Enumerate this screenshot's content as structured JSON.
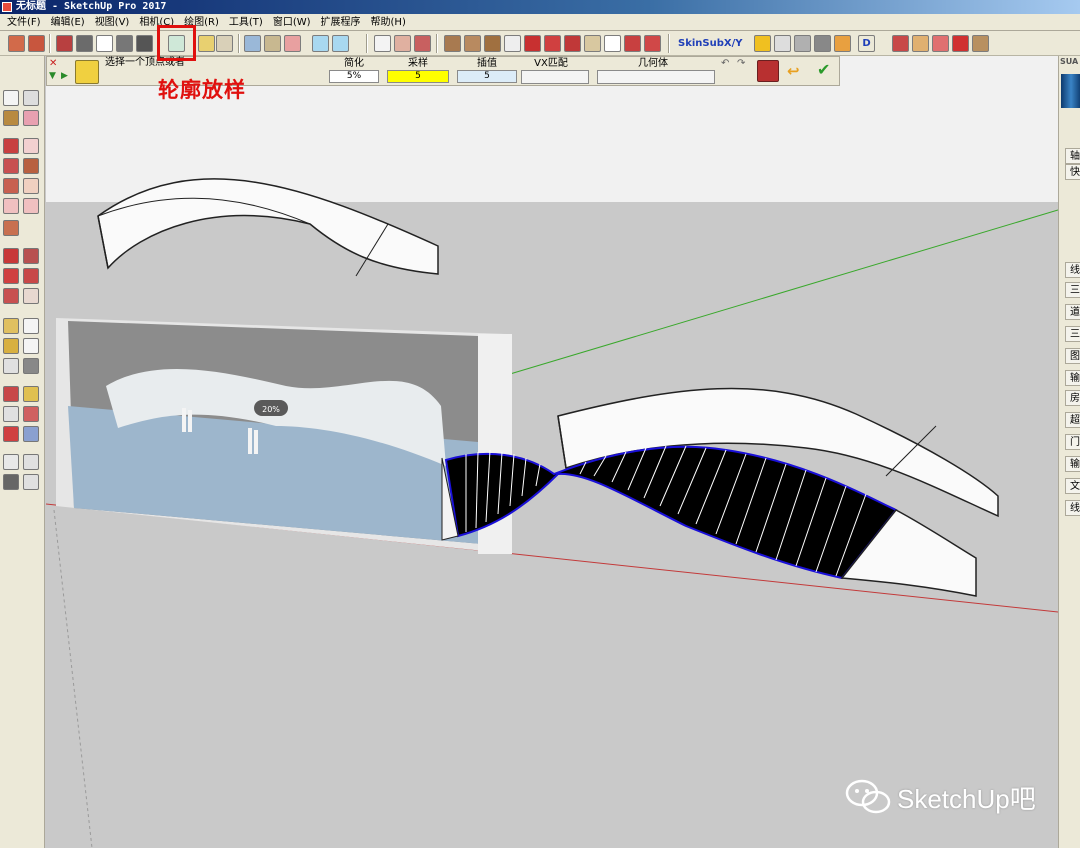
{
  "window": {
    "title": "无标题 - SketchUp Pro 2017"
  },
  "menu": [
    "文件(F)",
    "编辑(E)",
    "视图(V)",
    "相机(C)",
    "绘图(R)",
    "工具(T)",
    "窗口(W)",
    "扩展程序",
    "帮助(H)"
  ],
  "toolbar": {
    "skin_label": "SkinSubX/Y",
    "d_label": "D"
  },
  "command_bar": {
    "prompt": "选择一个顶点或者",
    "simplify": {
      "header": "简化",
      "value": "5%"
    },
    "sample": {
      "header": "采样",
      "value": "5"
    },
    "interp": {
      "header": "插值",
      "value": "5"
    },
    "vx_match": {
      "header": "VX匹配"
    },
    "geometry": {
      "header": "几何体"
    }
  },
  "annotation": {
    "label": "轮廓放样"
  },
  "scene": {
    "badge": "20%"
  },
  "right_panel": {
    "top_label": "SUA",
    "tabs": [
      "轴",
      "快",
      "线",
      "三",
      "道",
      "三",
      "图",
      "输",
      "房",
      "超",
      "门",
      "输",
      "文",
      "线"
    ]
  },
  "watermark": {
    "text": "SketchUp吧"
  },
  "colors": {
    "titlebar": "#0a246a",
    "highlight": "#e0100e",
    "edge_blue": "#1a10d8",
    "axis_green": "#39a82b",
    "axis_red": "#c33a3a"
  }
}
